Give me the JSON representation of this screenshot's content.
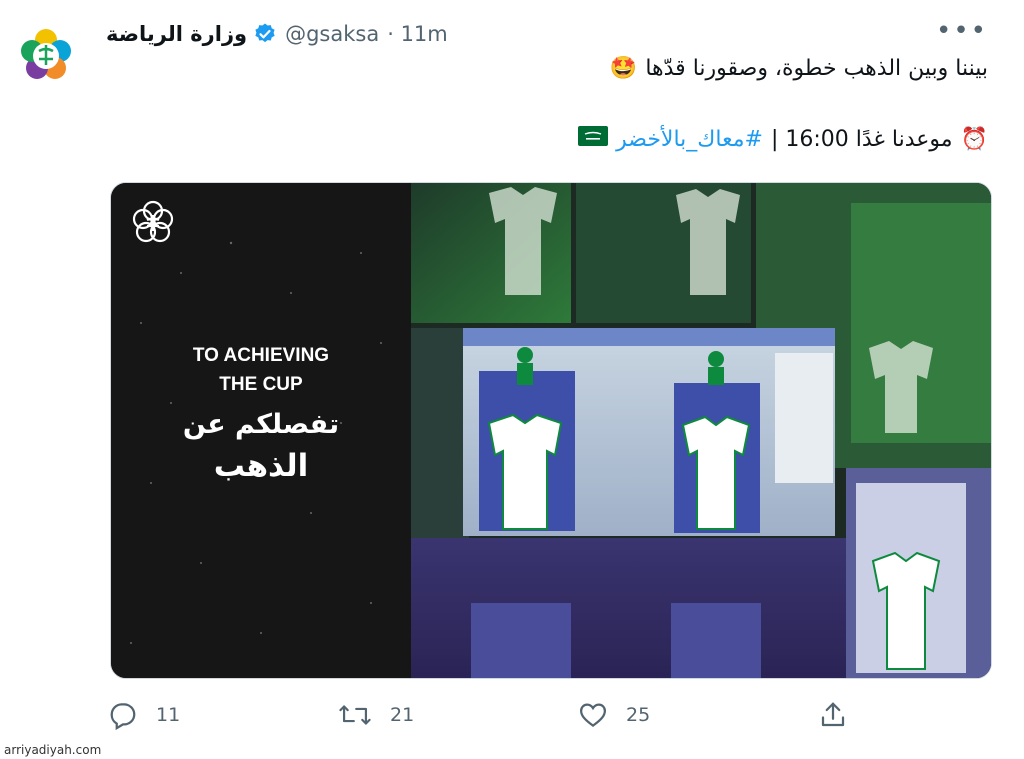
{
  "tweet": {
    "display_name": "وزارة الرياضة",
    "handle": "@gsaksa",
    "timestamp": "· 11m",
    "more_label": "•••",
    "line1": {
      "text": "بيننا وبين الذهب خطوة، وصقورنا قدّها",
      "emoji": "🤩"
    },
    "line2": {
      "emoji_clock": "⏰",
      "text": "موعدنا غدًا 16:00 |",
      "hashtag": "#معاك_بالأخضر",
      "flag_icon": "saudi-flag-icon"
    }
  },
  "media": {
    "title_en_line1": "TO ACHIEVING",
    "title_en_line2": "THE CUP",
    "title_ar_line1": "تفصلكم عن",
    "title_ar_line2": "الذهب"
  },
  "actions": {
    "reply_count": "11",
    "retweet_count": "21",
    "like_count": "25"
  },
  "watermark": "arriyadiyah.com",
  "colors": {
    "text": "#0f1419",
    "secondary": "#536471",
    "link": "#1d9bf0",
    "verified": "#1d9bf0",
    "jersey_green": "#0e8a3e"
  }
}
